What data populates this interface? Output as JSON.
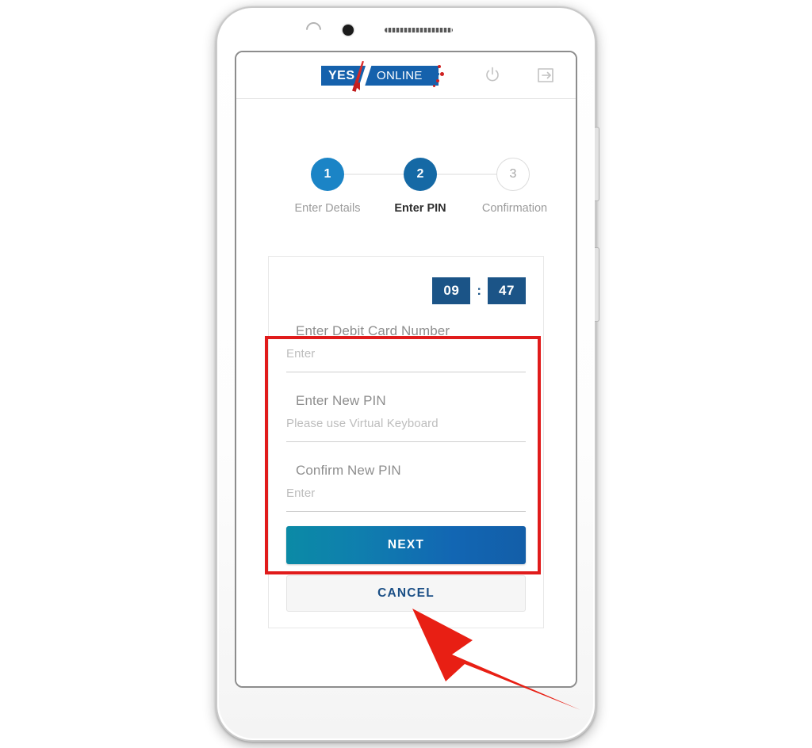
{
  "app": {
    "logo": {
      "primary_text": "YES",
      "secondary_text": "ONLINE",
      "brand_blue": "#1561ac",
      "brand_red": "#c41f1f"
    },
    "header_icons": {
      "power": "power-icon",
      "logout": "logout-icon"
    }
  },
  "stepper": {
    "steps": [
      {
        "number": "1",
        "label": "Enter Details",
        "state": "complete"
      },
      {
        "number": "2",
        "label": "Enter PIN",
        "state": "active"
      },
      {
        "number": "3",
        "label": "Confirmation",
        "state": "pending"
      }
    ]
  },
  "timer": {
    "minutes": "09",
    "separator": ":",
    "seconds": "47",
    "box_color": "#1b5487"
  },
  "form": {
    "fields": [
      {
        "label": "Enter Debit Card Number",
        "placeholder": "Enter",
        "value": ""
      },
      {
        "label": "Enter New PIN",
        "placeholder": "Please use Virtual Keyboard",
        "value": ""
      },
      {
        "label": "Confirm New PIN",
        "placeholder": "Enter",
        "value": ""
      }
    ]
  },
  "actions": {
    "next_label": "NEXT",
    "cancel_label": "CANCEL",
    "next_gradient_start": "#0b8aa6",
    "next_gradient_end": "#135ea8",
    "cancel_text_color": "#1b4f86"
  },
  "annotations": {
    "highlight_color": "#e01b1b",
    "box_target": "form-fields-group",
    "arrow_target": "next-button"
  }
}
